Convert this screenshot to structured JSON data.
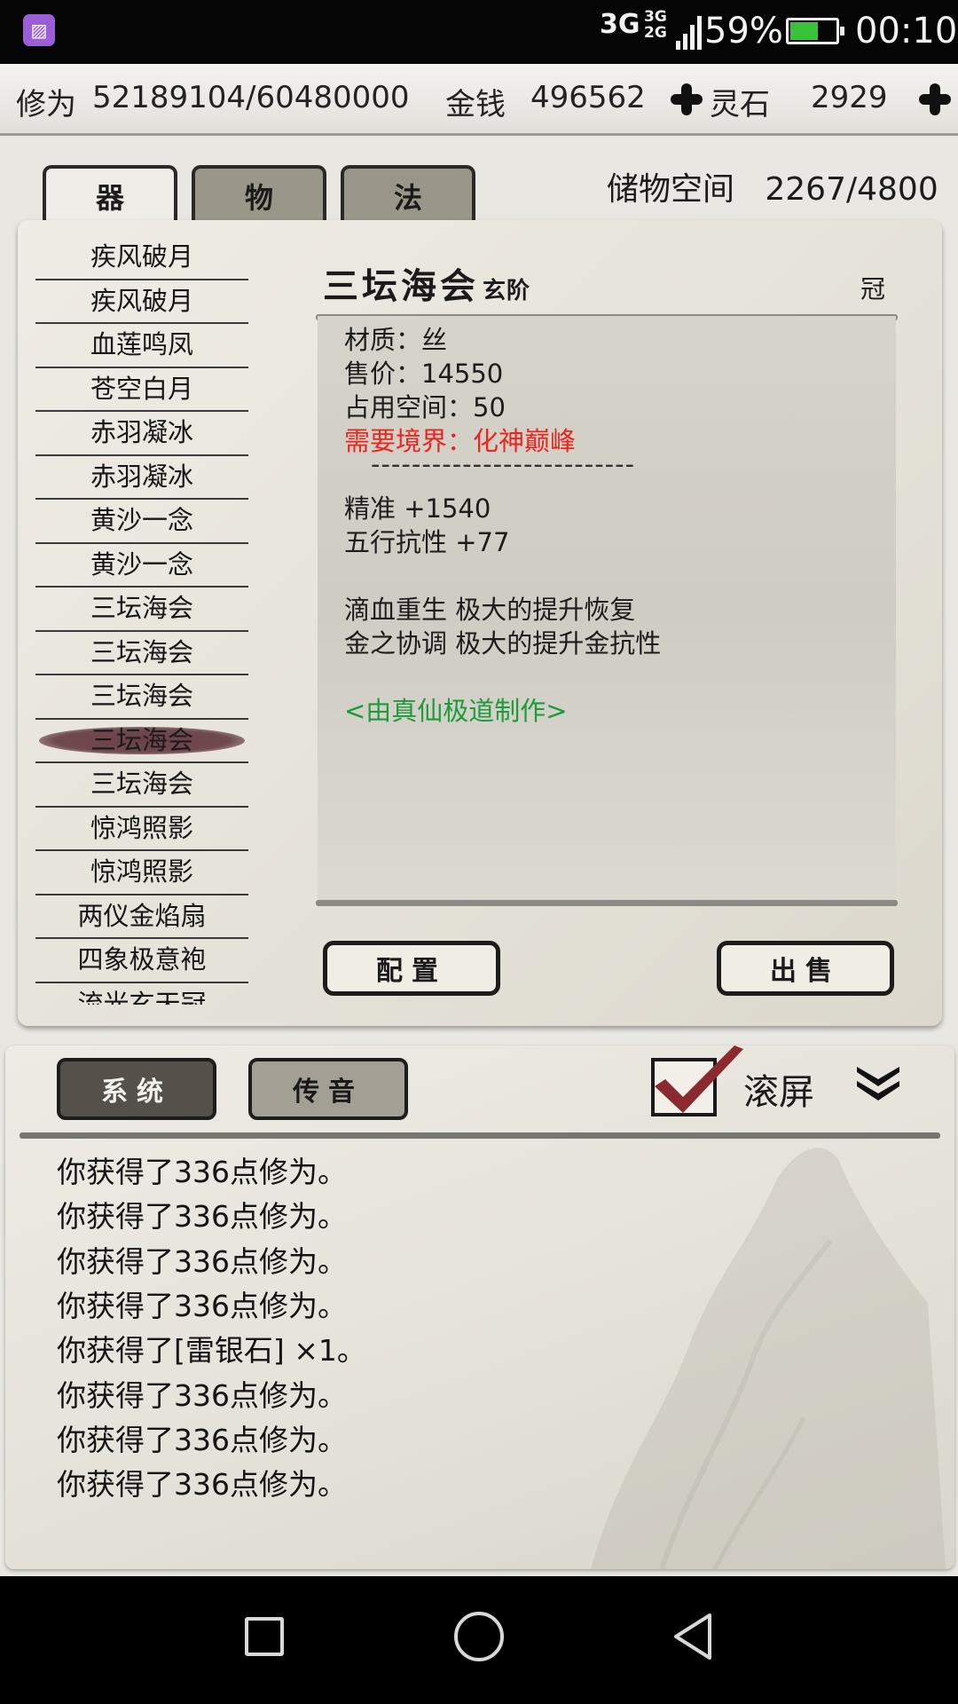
{
  "status_bar": {
    "network": "3G",
    "network2_top": "3G",
    "network2_bottom": "2G",
    "battery_percent": "59%",
    "battery_level": 0.59,
    "time": "00:10",
    "battery_color": "#38c238"
  },
  "info_bar": {
    "cultivation_label": "修为",
    "cultivation_value": "52189104/60480000",
    "money_label": "金钱",
    "money_value": "496562",
    "spirit_stone_label": "灵石",
    "spirit_stone_value": "2929"
  },
  "tabs": [
    {
      "label": "器",
      "active": true
    },
    {
      "label": "物",
      "active": false
    },
    {
      "label": "法",
      "active": false
    }
  ],
  "storage": {
    "label": "储物空间",
    "value": "2267/4800"
  },
  "items": [
    "疾风破月",
    "疾风破月",
    "血莲鸣凤",
    "苍空白月",
    "赤羽凝冰",
    "赤羽凝冰",
    "黄沙一念",
    "黄沙一念",
    "三坛海会",
    "三坛海会",
    "三坛海会",
    "三坛海会",
    "三坛海会",
    "惊鸿照影",
    "惊鸿照影",
    "两仪金焰扇",
    "四象极意袍",
    "流光玄天冠"
  ],
  "selected_item_index": 11,
  "detail": {
    "title": "三坛海会",
    "grade": "玄阶",
    "slot": "冠",
    "material": "材质：丝",
    "price": "售价：14550",
    "space": "占用空间：50",
    "requirement": "需要境界：化神巅峰",
    "divider": "--------------------------",
    "stat1": "精准 +1540",
    "stat2": "五行抗性 +77",
    "effect1": "滴血重生 极大的提升恢复",
    "effect2": "金之协调 极大的提升金抗性",
    "maker": "<由真仙极道制作>",
    "colors": {
      "requirement": "#e8251e",
      "maker": "#1d9a3a"
    }
  },
  "actions": {
    "equip_label": "配置",
    "sell_label": "出售"
  },
  "log": {
    "tab_system": "系统",
    "tab_message": "传音",
    "scroll_label": "滚屏",
    "scroll_checked": true,
    "lines": [
      "你获得了336点修为。",
      "你获得了336点修为。",
      "你获得了336点修为。",
      "你获得了336点修为。",
      "你获得了[雷银石] ×1。",
      "你获得了336点修为。",
      "你获得了336点修为。",
      "你获得了336点修为。"
    ]
  }
}
